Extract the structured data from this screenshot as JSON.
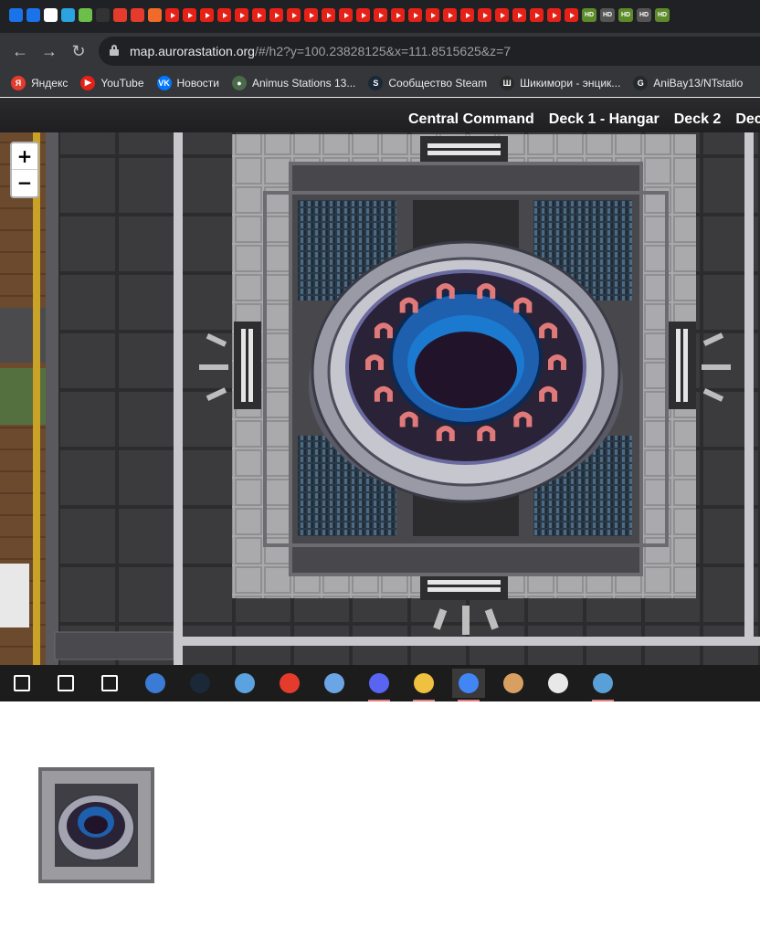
{
  "browser": {
    "url_host": "map.aurorastation.org",
    "url_path": "/#/h2?y=100.23828125&x=111.8515625&z=7",
    "tab_favicons": [
      "pause-icon",
      "chat-icon",
      "wiki-icon",
      "telegram-icon",
      "m-icon",
      "a-icon",
      "yandex-icon",
      "yandex-icon",
      "b-icon"
    ],
    "hd_labels": [
      "HD",
      "HD",
      "HD",
      "HD",
      "HD"
    ]
  },
  "bookmarks": [
    {
      "label": "Яндекс",
      "icon": "yandex-icon",
      "color": "#e53b2c",
      "glyph": "Я"
    },
    {
      "label": "YouTube",
      "icon": "youtube-icon",
      "color": "#e62117",
      "glyph": "▶"
    },
    {
      "label": "Новости",
      "icon": "vk-icon",
      "color": "#0077ff",
      "glyph": "VK"
    },
    {
      "label": "Animus Stations 13...",
      "icon": "animus-icon",
      "color": "#4a6a4a",
      "glyph": "●"
    },
    {
      "label": "Сообщество Steam",
      "icon": "steam-icon",
      "color": "#1b2838",
      "glyph": "S"
    },
    {
      "label": "Шикимори - энцик...",
      "icon": "shikimori-icon",
      "color": "#2a2a2a",
      "glyph": "Ш"
    },
    {
      "label": "AniBay13/NTstatio",
      "icon": "github-icon",
      "color": "#24292e",
      "glyph": "G"
    }
  ],
  "map": {
    "decks": [
      "Central Command",
      "Deck 1 - Hangar",
      "Deck 2",
      "Dec"
    ],
    "zoom_in": "+",
    "zoom_out": "−"
  },
  "taskbar": {
    "apps": [
      {
        "name": "start-icon",
        "color": "#ffffff"
      },
      {
        "name": "search-icon",
        "color": "#ffffff"
      },
      {
        "name": "task-view-icon",
        "color": "#ffffff"
      },
      {
        "name": "wallet-icon",
        "color": "#3a7bd5"
      },
      {
        "name": "steam-icon",
        "color": "#1b2838"
      },
      {
        "name": "news-icon",
        "color": "#5ba3e0"
      },
      {
        "name": "yandex-browser-icon",
        "color": "#e53b2c"
      },
      {
        "name": "bluetooth-icon",
        "color": "#6aa6e6"
      },
      {
        "name": "discord-icon",
        "color": "#5865f2"
      },
      {
        "name": "folder-icon",
        "color": "#f0c040"
      },
      {
        "name": "chrome-icon",
        "color": "#4285f4"
      },
      {
        "name": "paint-icon",
        "color": "#d8a060"
      },
      {
        "name": "twitch-icon",
        "color": "#e8e8e8"
      },
      {
        "name": "photos-icon",
        "color": "#5aa0d8"
      }
    ]
  }
}
